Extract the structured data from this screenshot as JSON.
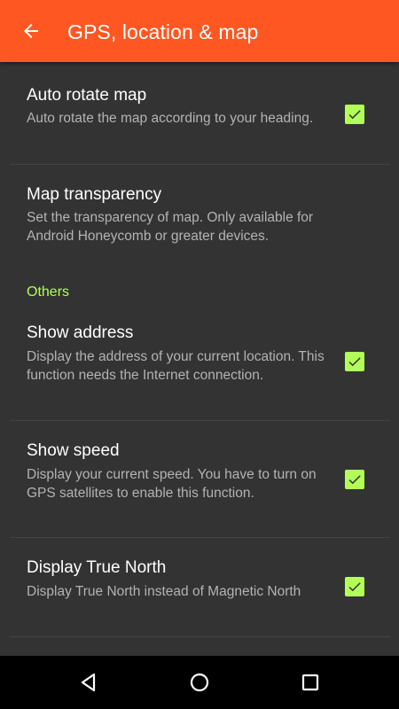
{
  "colors": {
    "app_bar": "#ff5722",
    "background": "#333333",
    "accent": "#b2ff59",
    "title_text": "#ffffff",
    "summary_text": "#b3b3b3",
    "nav_bar": "#000000"
  },
  "app_bar": {
    "back_icon": "arrow-left-icon",
    "title": "GPS, location & map"
  },
  "preferences": {
    "auto_rotate": {
      "title": "Auto rotate map",
      "summary": "Auto rotate the map according to your heading.",
      "checked": true
    },
    "map_transparency": {
      "title": "Map transparency",
      "summary": "Set the transparency of map. Only available for Android Honeycomb or greater devices."
    },
    "category_others": "Others",
    "show_address": {
      "title": "Show address",
      "summary": "Display the address of your current location. This function needs the Internet connection.",
      "checked": true
    },
    "show_speed": {
      "title": "Show speed",
      "summary": "Display your current speed. You have to turn on GPS satellites to enable this function.",
      "checked": true
    },
    "true_north": {
      "title": "Display True North",
      "summary": "Display True North instead of Magnetic North",
      "checked": true
    }
  },
  "nav_bar": {
    "back_icon": "triangle-back-icon",
    "home_icon": "circle-home-icon",
    "recents_icon": "square-recents-icon"
  }
}
